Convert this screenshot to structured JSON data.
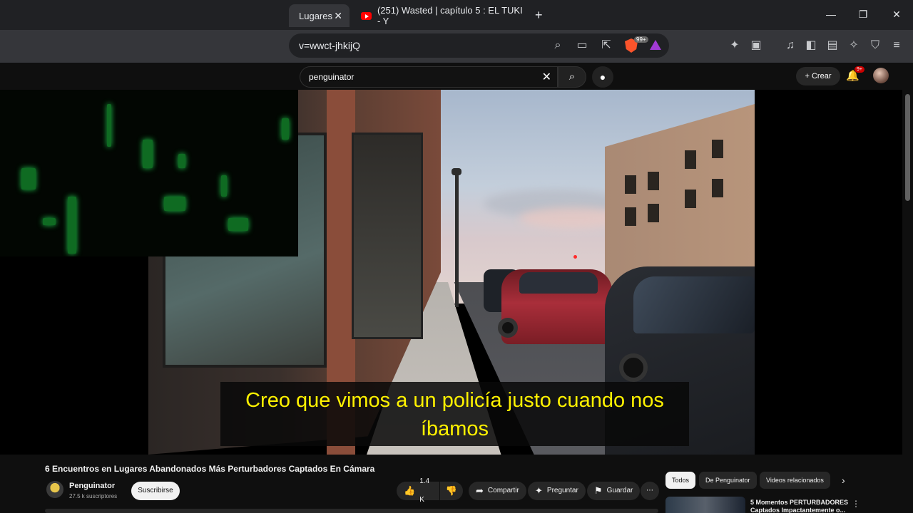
{
  "browser": {
    "tabs": [
      {
        "title": "Lugares",
        "close": "✕"
      },
      {
        "title": "(251) Wasted | capítulo 5 : EL TUKI - Y"
      }
    ],
    "new_tab": "+",
    "window_controls": {
      "minimize": "—",
      "maximize": "❐",
      "close": "✕"
    },
    "url": "v=wwct-jhkijQ",
    "brave_badge": "99+"
  },
  "masthead": {
    "search_value": "penguinator",
    "clear_icon": "✕",
    "search_icon": "⌕",
    "mic_icon": "🎤",
    "create_label": "+ Crear",
    "notifications_badge": "9+"
  },
  "player": {
    "caption": "Creo que vimos a un policía justo cuando nos íbamos"
  },
  "video": {
    "title": "6 Encuentros en Lugares Abandonados Más Perturbadores Captados En Cámara",
    "channel": "Penguinator",
    "subscribers": "27.5 k suscriptores",
    "subscribe_label": "Suscribirse",
    "likes": "1.4 K",
    "share_label": "Compartir",
    "ask_label": "Preguntar",
    "save_label": "Guardar",
    "more_label": "⋯"
  },
  "related": {
    "chips": [
      "Todos",
      "De Penguinator",
      "Videos relacionados"
    ],
    "next_icon": "›",
    "first_title": "5 Momentos PERTURBADORES Captados Impactantemente o...",
    "menu_icon": "⋮"
  },
  "colors": {
    "caption_text": "#fff200",
    "youtube_red": "#ff0000",
    "background": "#0f0f0f"
  }
}
